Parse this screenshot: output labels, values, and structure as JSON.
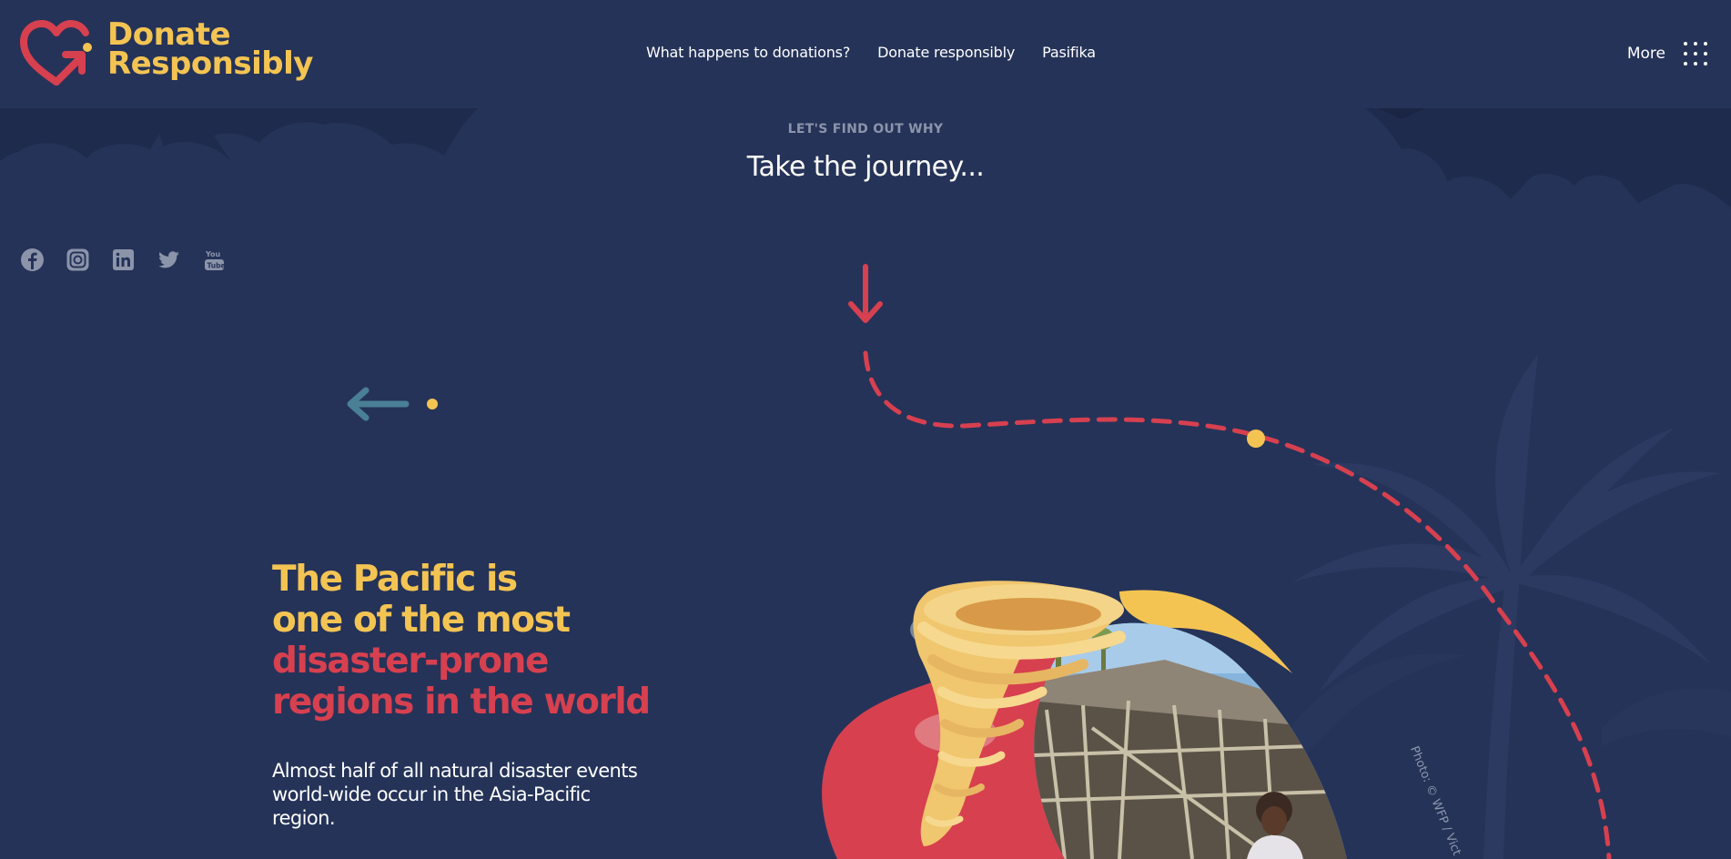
{
  "header": {
    "logo": {
      "line1": "Donate",
      "line2": "Responsibly"
    },
    "nav": [
      {
        "label": "What happens to donations?"
      },
      {
        "label": "Donate responsibly"
      },
      {
        "label": "Pasifika"
      }
    ],
    "more_label": "More"
  },
  "intro": {
    "eyebrow": "LET'S FIND OUT WHY",
    "title": "Take the journey..."
  },
  "social": [
    {
      "icon": "facebook-icon"
    },
    {
      "icon": "instagram-icon"
    },
    {
      "icon": "linkedin-icon"
    },
    {
      "icon": "twitter-icon"
    },
    {
      "icon": "youtube-icon"
    }
  ],
  "section": {
    "headline_line1": "The Pacific is",
    "headline_line2": "one of the most",
    "headline_line3": "disaster-prone",
    "headline_line4": "regions in the world",
    "body": "Almost half of all natural disaster events world-wide occur in the Asia-Pacific region."
  },
  "photo_credit": "Photo: © WFP / Vict",
  "colors": {
    "background": "#253359",
    "accent_yellow": "#f4c453",
    "accent_red": "#d7404f",
    "muted_teal": "#4a7f96"
  }
}
